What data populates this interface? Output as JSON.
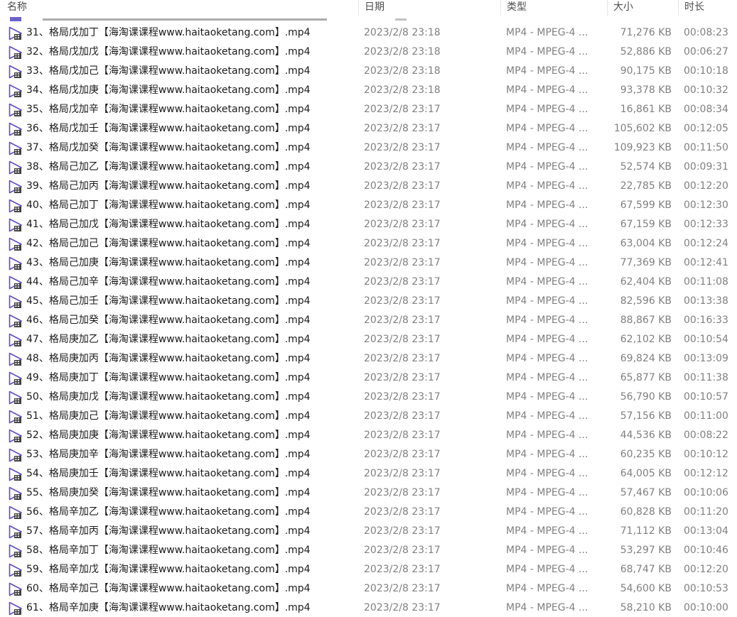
{
  "columns": {
    "name": "名称",
    "date": "日期",
    "type": "类型",
    "size": "大小",
    "duration": "时长"
  },
  "files": [
    {
      "name": "31、格局戊加丁【海淘课课程www.haitaoketang.com】.mp4",
      "date": "2023/2/8 23:18",
      "type": "MP4 - MPEG-4 ...",
      "size": "71,276 KB",
      "duration": "00:08:23"
    },
    {
      "name": "32、格局戊加戊【海淘课课程www.haitaoketang.com】.mp4",
      "date": "2023/2/8 23:18",
      "type": "MP4 - MPEG-4 ...",
      "size": "52,886 KB",
      "duration": "00:06:27"
    },
    {
      "name": "33、格局戊加己【海淘课课程www.haitaoketang.com】.mp4",
      "date": "2023/2/8 23:18",
      "type": "MP4 - MPEG-4 ...",
      "size": "90,175 KB",
      "duration": "00:10:18"
    },
    {
      "name": "34、格局戊加庚【海淘课课程www.haitaoketang.com】.mp4",
      "date": "2023/2/8 23:18",
      "type": "MP4 - MPEG-4 ...",
      "size": "93,378 KB",
      "duration": "00:10:32"
    },
    {
      "name": "35、格局戊加辛【海淘课课程www.haitaoketang.com】.mp4",
      "date": "2023/2/8 23:17",
      "type": "MP4 - MPEG-4 ...",
      "size": "16,861 KB",
      "duration": "00:08:34"
    },
    {
      "name": "36、格局戊加壬【海淘课课程www.haitaoketang.com】.mp4",
      "date": "2023/2/8 23:17",
      "type": "MP4 - MPEG-4 ...",
      "size": "105,602 KB",
      "duration": "00:12:05"
    },
    {
      "name": "37、格局戊加癸【海淘课课程www.haitaoketang.com】.mp4",
      "date": "2023/2/8 23:17",
      "type": "MP4 - MPEG-4 ...",
      "size": "109,923 KB",
      "duration": "00:11:50"
    },
    {
      "name": "38、格局己加乙【海淘课课程www.haitaoketang.com】.mp4",
      "date": "2023/2/8 23:17",
      "type": "MP4 - MPEG-4 ...",
      "size": "52,574 KB",
      "duration": "00:09:31"
    },
    {
      "name": "39、格局己加丙【海淘课课程www.haitaoketang.com】.mp4",
      "date": "2023/2/8 23:17",
      "type": "MP4 - MPEG-4 ...",
      "size": "22,785 KB",
      "duration": "00:12:20"
    },
    {
      "name": "40、格局己加丁【海淘课课程www.haitaoketang.com】.mp4",
      "date": "2023/2/8 23:17",
      "type": "MP4 - MPEG-4 ...",
      "size": "67,599 KB",
      "duration": "00:12:30"
    },
    {
      "name": "41、格局己加戊【海淘课课程www.haitaoketang.com】.mp4",
      "date": "2023/2/8 23:17",
      "type": "MP4 - MPEG-4 ...",
      "size": "67,159 KB",
      "duration": "00:12:33"
    },
    {
      "name": "42、格局己加己【海淘课课程www.haitaoketang.com】.mp4",
      "date": "2023/2/8 23:17",
      "type": "MP4 - MPEG-4 ...",
      "size": "63,004 KB",
      "duration": "00:12:24"
    },
    {
      "name": "43、格局己加庚【海淘课课程www.haitaoketang.com】.mp4",
      "date": "2023/2/8 23:17",
      "type": "MP4 - MPEG-4 ...",
      "size": "77,369 KB",
      "duration": "00:12:41"
    },
    {
      "name": "44、格局己加辛【海淘课课程www.haitaoketang.com】.mp4",
      "date": "2023/2/8 23:17",
      "type": "MP4 - MPEG-4 ...",
      "size": "62,404 KB",
      "duration": "00:11:08"
    },
    {
      "name": "45、格局己加壬【海淘课课程www.haitaoketang.com】.mp4",
      "date": "2023/2/8 23:17",
      "type": "MP4 - MPEG-4 ...",
      "size": "82,596 KB",
      "duration": "00:13:38"
    },
    {
      "name": "46、格局己加癸【海淘课课程www.haitaoketang.com】.mp4",
      "date": "2023/2/8 23:17",
      "type": "MP4 - MPEG-4 ...",
      "size": "88,867 KB",
      "duration": "00:16:33"
    },
    {
      "name": "47、格局庚加乙【海淘课课程www.haitaoketang.com】.mp4",
      "date": "2023/2/8 23:17",
      "type": "MP4 - MPEG-4 ...",
      "size": "62,102 KB",
      "duration": "00:10:54"
    },
    {
      "name": "48、格局庚加丙【海淘课课程www.haitaoketang.com】.mp4",
      "date": "2023/2/8 23:17",
      "type": "MP4 - MPEG-4 ...",
      "size": "69,824 KB",
      "duration": "00:13:09"
    },
    {
      "name": "49、格局庚加丁【海淘课课程www.haitaoketang.com】.mp4",
      "date": "2023/2/8 23:17",
      "type": "MP4 - MPEG-4 ...",
      "size": "65,877 KB",
      "duration": "00:11:38"
    },
    {
      "name": "50、格局庚加戊【海淘课课程www.haitaoketang.com】.mp4",
      "date": "2023/2/8 23:17",
      "type": "MP4 - MPEG-4 ...",
      "size": "56,790 KB",
      "duration": "00:10:57"
    },
    {
      "name": "51、格局庚加己【海淘课课程www.haitaoketang.com】.mp4",
      "date": "2023/2/8 23:17",
      "type": "MP4 - MPEG-4 ...",
      "size": "57,156 KB",
      "duration": "00:11:00"
    },
    {
      "name": "52、格局庚加庚【海淘课课程www.haitaoketang.com】.mp4",
      "date": "2023/2/8 23:17",
      "type": "MP4 - MPEG-4 ...",
      "size": "44,536 KB",
      "duration": "00:08:22"
    },
    {
      "name": "53、格局庚加辛【海淘课课程www.haitaoketang.com】.mp4",
      "date": "2023/2/8 23:17",
      "type": "MP4 - MPEG-4 ...",
      "size": "60,235 KB",
      "duration": "00:10:12"
    },
    {
      "name": "54、格局庚加壬【海淘课课程www.haitaoketang.com】.mp4",
      "date": "2023/2/8 23:17",
      "type": "MP4 - MPEG-4 ...",
      "size": "64,005 KB",
      "duration": "00:12:12"
    },
    {
      "name": "55、格局庚加癸【海淘课课程www.haitaoketang.com】.mp4",
      "date": "2023/2/8 23:17",
      "type": "MP4 - MPEG-4 ...",
      "size": "57,467 KB",
      "duration": "00:10:06"
    },
    {
      "name": "56、格局辛加乙【海淘课课程www.haitaoketang.com】.mp4",
      "date": "2023/2/8 23:17",
      "type": "MP4 - MPEG-4 ...",
      "size": "60,828 KB",
      "duration": "00:11:20"
    },
    {
      "name": "57、格局辛加丙【海淘课课程www.haitaoketang.com】.mp4",
      "date": "2023/2/8 23:17",
      "type": "MP4 - MPEG-4 ...",
      "size": "71,112 KB",
      "duration": "00:13:04"
    },
    {
      "name": "58、格局辛加丁【海淘课课程www.haitaoketang.com】.mp4",
      "date": "2023/2/8 23:17",
      "type": "MP4 - MPEG-4 ...",
      "size": "53,297 KB",
      "duration": "00:10:46"
    },
    {
      "name": "59、格局辛加戊【海淘课课程www.haitaoketang.com】.mp4",
      "date": "2023/2/8 23:17",
      "type": "MP4 - MPEG-4 ...",
      "size": "68,747 KB",
      "duration": "00:12:20"
    },
    {
      "name": "60、格局辛加己【海淘课课程www.haitaoketang.com】.mp4",
      "date": "2023/2/8 23:17",
      "type": "MP4 - MPEG-4 ...",
      "size": "54,600 KB",
      "duration": "00:10:53"
    },
    {
      "name": "61、格局辛加庚【海淘课课程www.haitaoketang.com】.mp4",
      "date": "2023/2/8 23:17",
      "type": "MP4 - MPEG-4 ...",
      "size": "58,210 KB",
      "duration": "00:10:00"
    }
  ],
  "icons": {
    "video_file": "video-file-icon"
  },
  "colors": {
    "icon_accent": "#5b4fc7",
    "name_text": "#1a1a1a",
    "meta_text": "#808080",
    "header_text": "#4d4d4d"
  }
}
